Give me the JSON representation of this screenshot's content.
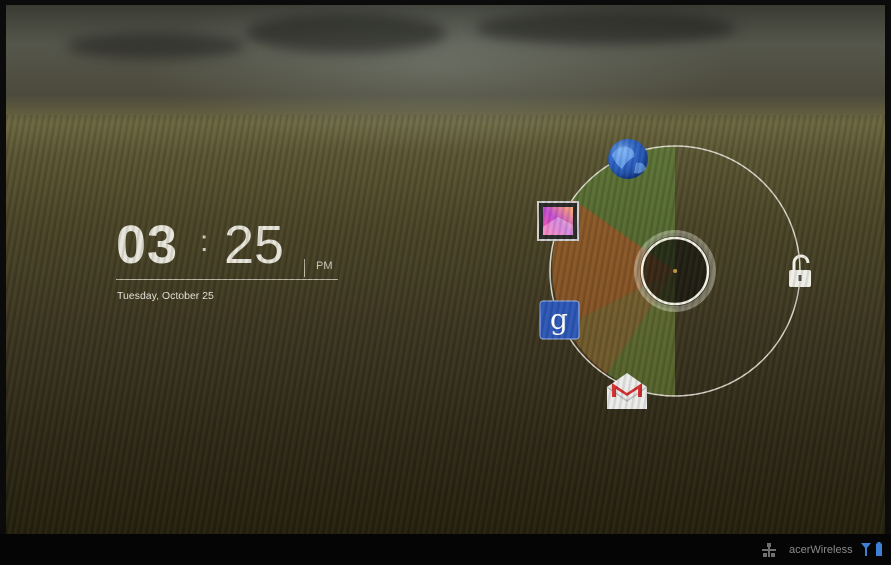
{
  "lockscreen": {
    "clock": {
      "hours": "03",
      "colon": ":",
      "minutes": "25",
      "ampm": "PM",
      "date": "Tuesday, October 25"
    },
    "ring_shortcuts": [
      "browser-icon",
      "gallery-icon",
      "google-search-icon",
      "gmail-icon",
      "unlock-icon"
    ],
    "colors": {
      "ring": "#e8e6dc",
      "wedge_green": "#5f8a3a",
      "wedge_orange": "#c06a2a",
      "wedge_red": "#b23a2a"
    }
  },
  "statusbar": {
    "network_name": "acerWireless",
    "icons": [
      "network-icon",
      "signal-icon",
      "battery-icon"
    ]
  }
}
